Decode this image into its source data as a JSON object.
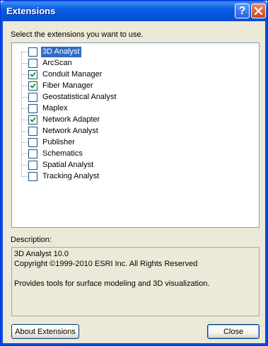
{
  "window": {
    "title": "Extensions",
    "help_glyph": "?",
    "close_icon": "close-icon"
  },
  "instruction": "Select the extensions you want to use.",
  "extensions": [
    {
      "label": "3D Analyst",
      "checked": false,
      "selected": true
    },
    {
      "label": "ArcScan",
      "checked": false,
      "selected": false
    },
    {
      "label": "Conduit Manager",
      "checked": true,
      "selected": false
    },
    {
      "label": "Fiber Manager",
      "checked": true,
      "selected": false
    },
    {
      "label": "Geostatistical Analyst",
      "checked": false,
      "selected": false
    },
    {
      "label": "Maplex",
      "checked": false,
      "selected": false
    },
    {
      "label": "Network Adapter",
      "checked": true,
      "selected": false
    },
    {
      "label": "Network Analyst",
      "checked": false,
      "selected": false
    },
    {
      "label": "Publisher",
      "checked": false,
      "selected": false
    },
    {
      "label": "Schematics",
      "checked": false,
      "selected": false
    },
    {
      "label": "Spatial Analyst",
      "checked": false,
      "selected": false
    },
    {
      "label": "Tracking Analyst",
      "checked": false,
      "selected": false
    }
  ],
  "description": {
    "label": "Description:",
    "name_line": "3D Analyst 10.0",
    "copyright_line": "Copyright ©1999-2010 ESRI Inc. All Rights Reserved",
    "details": "Provides tools for surface modeling and 3D visualization."
  },
  "buttons": {
    "about_label": "About Extensions",
    "close_label": "Close"
  },
  "colors": {
    "titlebar": "#0a5fe5",
    "selection": "#316ac5",
    "dialog_bg": "#ece9d8"
  }
}
